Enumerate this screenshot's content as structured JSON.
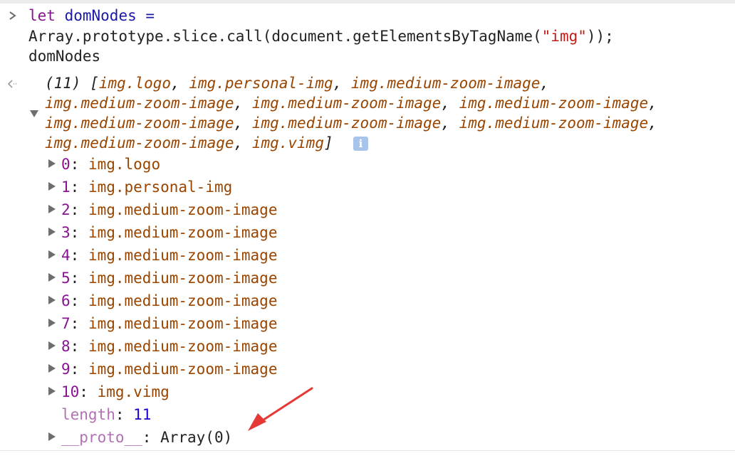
{
  "input": {
    "line1": {
      "keyword": "let",
      "identifier": "domNodes",
      "operator": "="
    },
    "line2": {
      "prefix": "Array.prototype.slice.call(document.getElementsByTagName(",
      "string": "\"img\"",
      "suffix": "));"
    },
    "line3": "domNodes"
  },
  "result": {
    "preview_lines": [
      [
        "(11) [",
        "img.logo",
        ", ",
        "img.personal-img",
        ", ",
        "img.medium-zoom-image",
        ","
      ],
      [
        "img.medium-zoom-image",
        ", ",
        "img.medium-zoom-image",
        ", ",
        "img.medium-zoom-image",
        ","
      ],
      [
        "img.medium-zoom-image",
        ", ",
        "img.medium-zoom-image",
        ", ",
        "img.medium-zoom-image",
        ","
      ],
      [
        "img.medium-zoom-image",
        ", ",
        "img.vimg",
        "]"
      ]
    ],
    "info_badge": "i",
    "items": [
      {
        "index": "0",
        "value": "img.logo"
      },
      {
        "index": "1",
        "value": "img.personal-img"
      },
      {
        "index": "2",
        "value": "img.medium-zoom-image"
      },
      {
        "index": "3",
        "value": "img.medium-zoom-image"
      },
      {
        "index": "4",
        "value": "img.medium-zoom-image"
      },
      {
        "index": "5",
        "value": "img.medium-zoom-image"
      },
      {
        "index": "6",
        "value": "img.medium-zoom-image"
      },
      {
        "index": "7",
        "value": "img.medium-zoom-image"
      },
      {
        "index": "8",
        "value": "img.medium-zoom-image"
      },
      {
        "index": "9",
        "value": "img.medium-zoom-image"
      },
      {
        "index": "10",
        "value": "img.vimg"
      }
    ],
    "length": {
      "key": "length",
      "value": "11"
    },
    "proto": {
      "key": "__proto__",
      "value": "Array(0)"
    }
  },
  "colors": {
    "keyword": "#881391",
    "identifier": "#1a1aa6",
    "string": "#c41a16",
    "property": "#881391",
    "node_value": "#994500",
    "number": "#1c00cf",
    "annotation_arrow": "#e53935",
    "info_badge": "#a9c4ea"
  },
  "icons": {
    "prompt": "chevron-right-icon",
    "result": "return-arrow-icon",
    "expanded": "triangle-down-icon",
    "collapsed": "triangle-right-icon",
    "info": "info-icon",
    "annotation": "red-arrow-icon"
  }
}
